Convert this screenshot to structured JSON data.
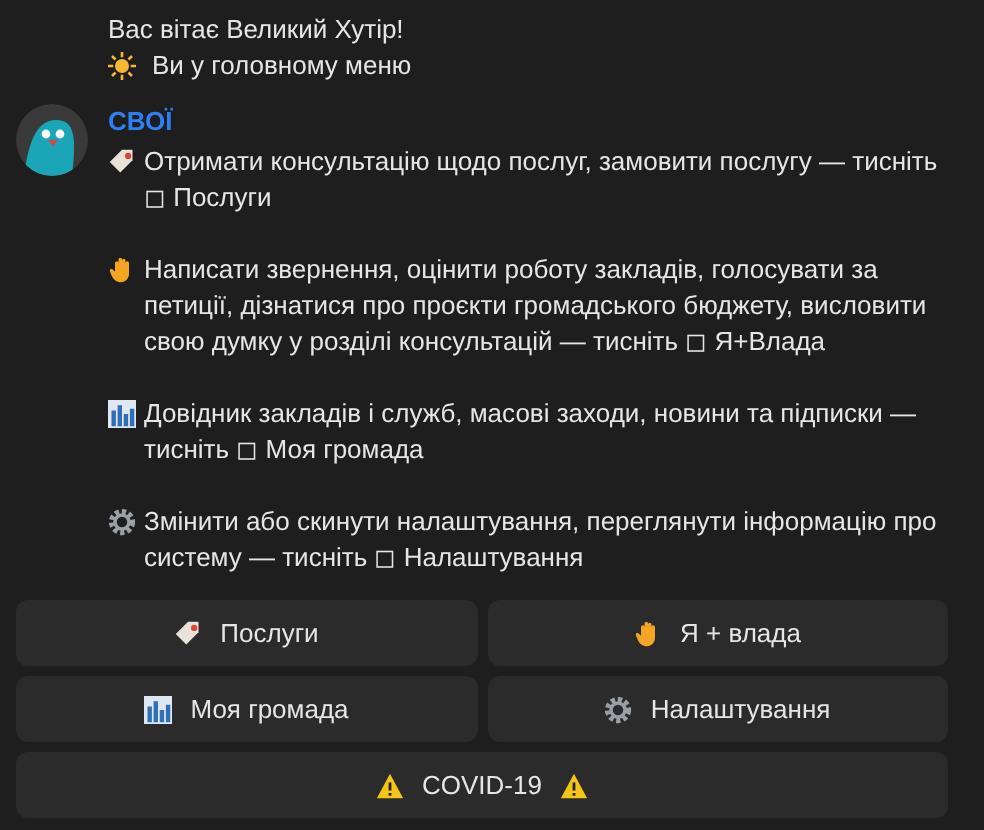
{
  "greeting": [
    {
      "text": "Вас вітає Великий Хутір!"
    },
    {
      "text": "Ви у головному меню"
    }
  ],
  "message": {
    "sender": "СВОЇ",
    "paragraphs": [
      {
        "text": "Отримати консультацію щодо послуг, замовити послугу — тисніть ◻ Послуги"
      },
      {
        "text": "Написати звернення, оцінити роботу закладів, голосувати за петиції, дізнатися про проєкти громадського бюджету, висловити свою думку у розділі консультацій — тисніть ◻ Я+Влада"
      },
      {
        "text": "Довідник закладів і служб, масові заходи, новини та підписки — тисніть ◻ Моя громада"
      },
      {
        "text": "Змінити або скинути налаштування, переглянути інформацію про систему — тисніть ◻ Налаштування"
      }
    ]
  },
  "keyboard": [
    [
      {
        "label": "Послуги"
      },
      {
        "label": "Я + влада"
      }
    ],
    [
      {
        "label": "Моя громада"
      },
      {
        "label": "Налаштування"
      }
    ],
    [
      {
        "label": "COVID-19"
      }
    ]
  ]
}
